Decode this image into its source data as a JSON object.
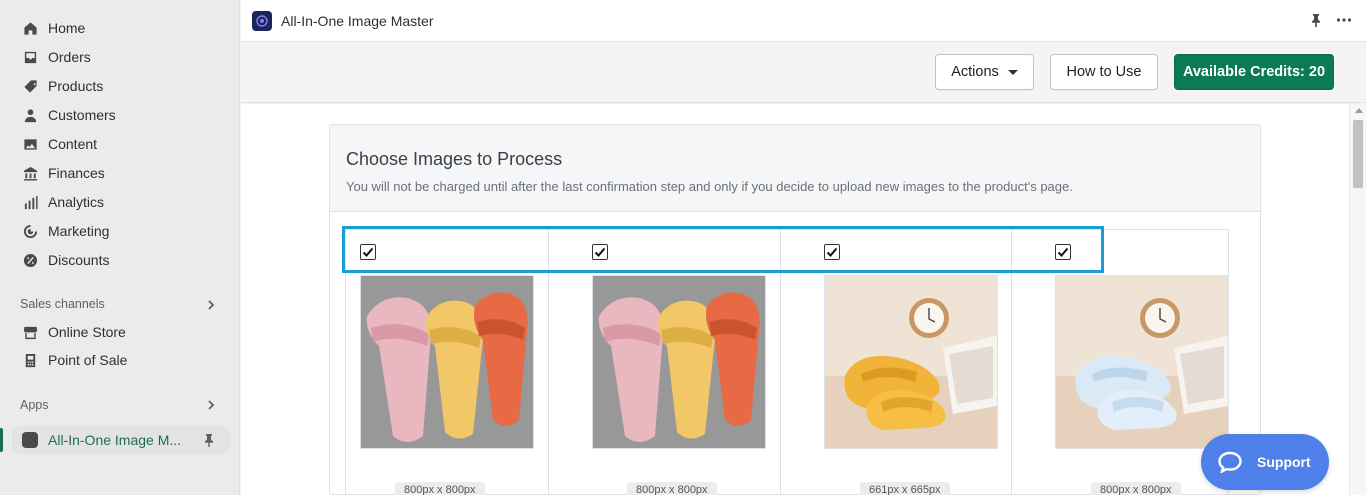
{
  "sidebar": {
    "items": [
      {
        "label": "Home",
        "icon": "home-icon"
      },
      {
        "label": "Orders",
        "icon": "inbox-icon"
      },
      {
        "label": "Products",
        "icon": "tag-icon"
      },
      {
        "label": "Customers",
        "icon": "person-icon"
      },
      {
        "label": "Content",
        "icon": "image-icon"
      },
      {
        "label": "Finances",
        "icon": "bank-icon"
      },
      {
        "label": "Analytics",
        "icon": "bar-chart-icon"
      },
      {
        "label": "Marketing",
        "icon": "target-icon"
      },
      {
        "label": "Discounts",
        "icon": "percent-badge-icon"
      }
    ],
    "sales_channels_label": "Sales channels",
    "channels": [
      {
        "label": "Online Store",
        "icon": "store-icon"
      },
      {
        "label": "Point of Sale",
        "icon": "pos-icon"
      }
    ],
    "apps_label": "Apps",
    "active_app": {
      "label": "All-In-One Image M...",
      "icon": "app-icon"
    }
  },
  "titlebar": {
    "title": "All-In-One Image Master"
  },
  "actions": {
    "actions_label": "Actions",
    "how_to_use_label": "How to Use",
    "credits_label": "Available Credits: 20"
  },
  "card": {
    "title": "Choose Images to Process",
    "subtitle": "You will not be charged until after the last confirmation step and only if you decide to upload new images to the product's page."
  },
  "images": [
    {
      "checked": true,
      "size": "800px x 800px"
    },
    {
      "checked": true,
      "size": "800px x 800px"
    },
    {
      "checked": true,
      "size": "661px x 665px"
    },
    {
      "checked": true,
      "size": "800px x 800px"
    }
  ],
  "support": {
    "label": "Support"
  },
  "colors": {
    "primary": "#0b7a55",
    "highlight": "#1a9cd8",
    "support": "#4f7fe8",
    "active_nav_text": "#1e6e4e"
  }
}
